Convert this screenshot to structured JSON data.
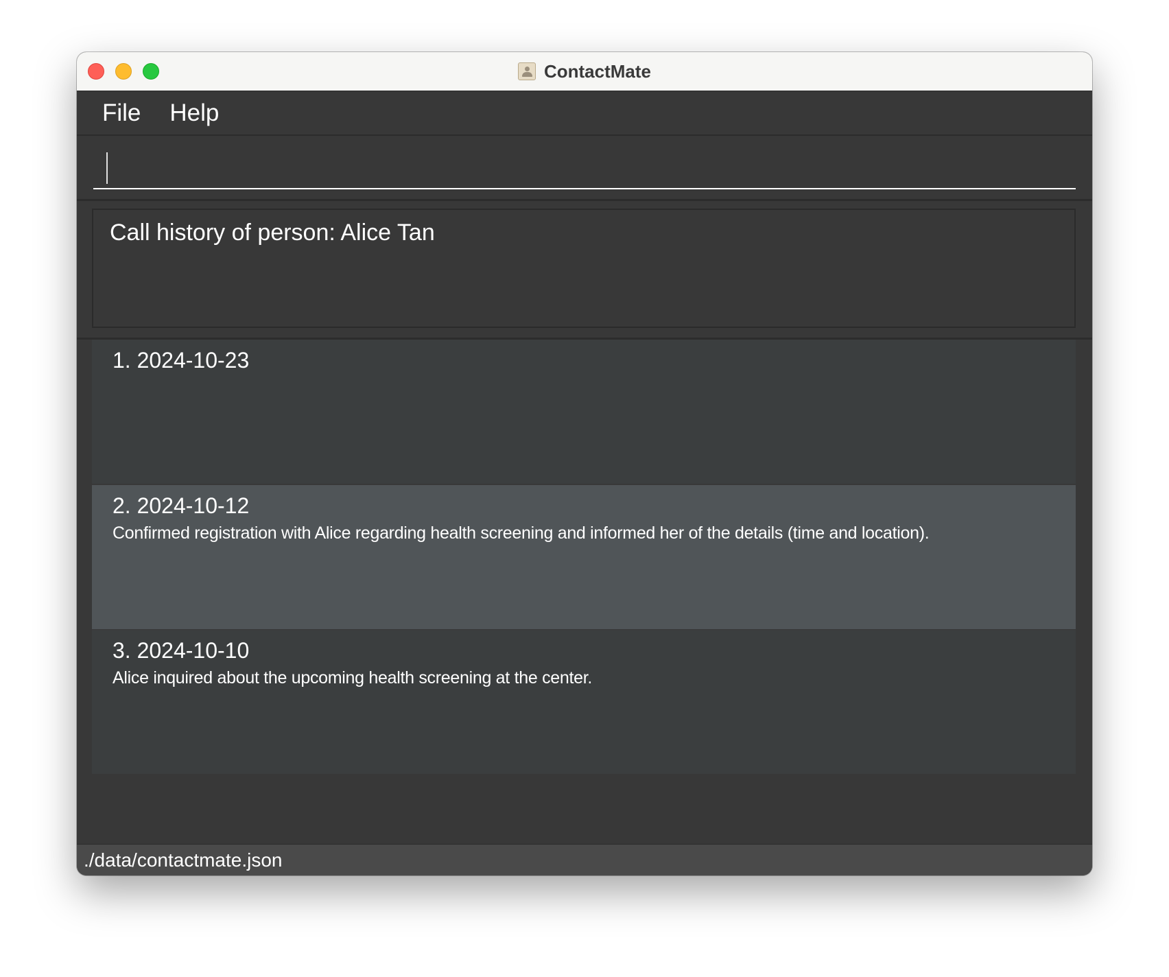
{
  "window": {
    "title": "ContactMate",
    "app_icon": "contact-card-icon"
  },
  "menubar": {
    "items": [
      "File",
      "Help"
    ]
  },
  "command": {
    "value": "",
    "placeholder": ""
  },
  "result": {
    "text": "Call history of person: Alice Tan"
  },
  "calls": [
    {
      "label": "1. 2024-10-23",
      "note": ""
    },
    {
      "label": "2. 2024-10-12",
      "note": "Confirmed registration with Alice regarding health screening and informed her of the details (time and location)."
    },
    {
      "label": "3. 2024-10-10",
      "note": "Alice inquired about the upcoming health screening at the center."
    }
  ],
  "status": {
    "file_path": "./data/contactmate.json"
  },
  "colors": {
    "window_bg": "#383838",
    "card_bg": "#3b3e3f",
    "card_selected_bg": "#505558",
    "statusbar_bg": "#4a4a4a",
    "text": "#ffffff",
    "close": "#fe5f57",
    "minimize": "#febc2e",
    "maximize": "#28c840"
  }
}
